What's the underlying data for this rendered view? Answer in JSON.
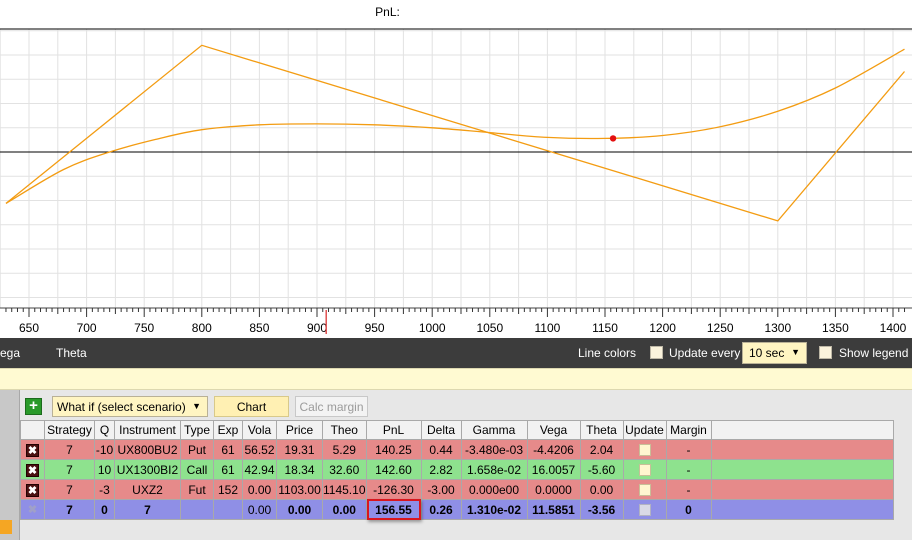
{
  "chart": {
    "title": "PnL:",
    "x_ticks": [
      "650",
      "700",
      "750",
      "800",
      "850",
      "900",
      "950",
      "1000",
      "1050",
      "1100",
      "1150",
      "1200",
      "1250",
      "1300",
      "1350",
      "1400"
    ]
  },
  "chart_data": {
    "type": "line",
    "title": "PnL:",
    "xlabel": "",
    "ylabel": "",
    "xlim": [
      630,
      1410
    ],
    "grid": true,
    "current_price_marker": 908,
    "series": [
      {
        "name": "",
        "style": "expiry-payoff",
        "x": [
          630,
          800,
          1300,
          1410
        ],
        "y": [
          -53,
          110,
          -71,
          83
        ]
      },
      {
        "name": "",
        "style": "current-theo",
        "x": [
          630,
          680,
          720,
          760,
          800,
          850,
          900,
          950,
          1000,
          1050,
          1100,
          1150,
          1200,
          1250,
          1300,
          1350,
          1410
        ],
        "y": [
          -53,
          -18,
          0,
          13,
          23,
          28,
          29,
          28,
          25,
          20,
          15,
          14,
          17,
          26,
          42,
          66,
          106
        ]
      }
    ],
    "marker_point": {
      "x": 1157,
      "y": 14
    },
    "y_range_visible": [
      -120,
      125
    ]
  },
  "toolbar": {
    "vega_partial": "ega",
    "theta": "Theta",
    "line_colors": "Line colors",
    "update_every": "Update every",
    "update_interval": "10 sec",
    "show_legend": "Show legend"
  },
  "panel": {
    "add": "+",
    "scenario": "What if (select scenario)",
    "chart_button": "Chart",
    "calc_margin_button": "Calc margin"
  },
  "table": {
    "headers": [
      "",
      "Strategy",
      "Q",
      "Instrument",
      "Type",
      "Exp",
      "Vola",
      "Price",
      "Theo",
      "PnL",
      "Delta",
      "Gamma",
      "Vega",
      "Theta",
      "Update",
      "Margin"
    ],
    "rows": [
      {
        "strategy": "7",
        "q": "-10",
        "instrument": "UX800BU2",
        "type": "Put",
        "exp": "61",
        "vola": "56.52",
        "price": "19.31",
        "theo": "5.29",
        "pnl": "140.25",
        "delta": "0.44",
        "gamma": "-3.480e-03",
        "vega": "-4.4206",
        "theta": "2.04",
        "margin": "-"
      },
      {
        "strategy": "7",
        "q": "10",
        "instrument": "UX1300BI2",
        "type": "Call",
        "exp": "61",
        "vola": "42.94",
        "price": "18.34",
        "theo": "32.60",
        "pnl": "142.60",
        "delta": "2.82",
        "gamma": "1.658e-02",
        "vega": "16.0057",
        "theta": "-5.60",
        "margin": "-"
      },
      {
        "strategy": "7",
        "q": "-3",
        "instrument": "UXZ2",
        "type": "Fut",
        "exp": "152",
        "vola": "0.00",
        "price": "1103.00",
        "theo": "1145.10",
        "pnl": "-126.30",
        "delta": "-3.00",
        "gamma": "0.000e00",
        "vega": "0.0000",
        "theta": "0.00",
        "margin": "-"
      }
    ],
    "total": {
      "strategy": "7",
      "q": "0",
      "instrument": "7",
      "type": "",
      "exp": "",
      "vola": "0.00",
      "price": "0.00",
      "theo": "0.00",
      "pnl": "156.55",
      "delta": "0.26",
      "gamma": "1.310e-02",
      "vega": "11.5851",
      "theta": "-3.56",
      "margin": "0"
    },
    "delete_glyph": "✖"
  },
  "colors": {
    "payoff_line": "#f39c12",
    "marker": "#e31010",
    "toolbar_bg": "#3c3c3c",
    "row_red": "#e68a8a",
    "row_green": "#8ee28e",
    "row_total": "#8f8fe6",
    "highlight": "#d9161e"
  }
}
